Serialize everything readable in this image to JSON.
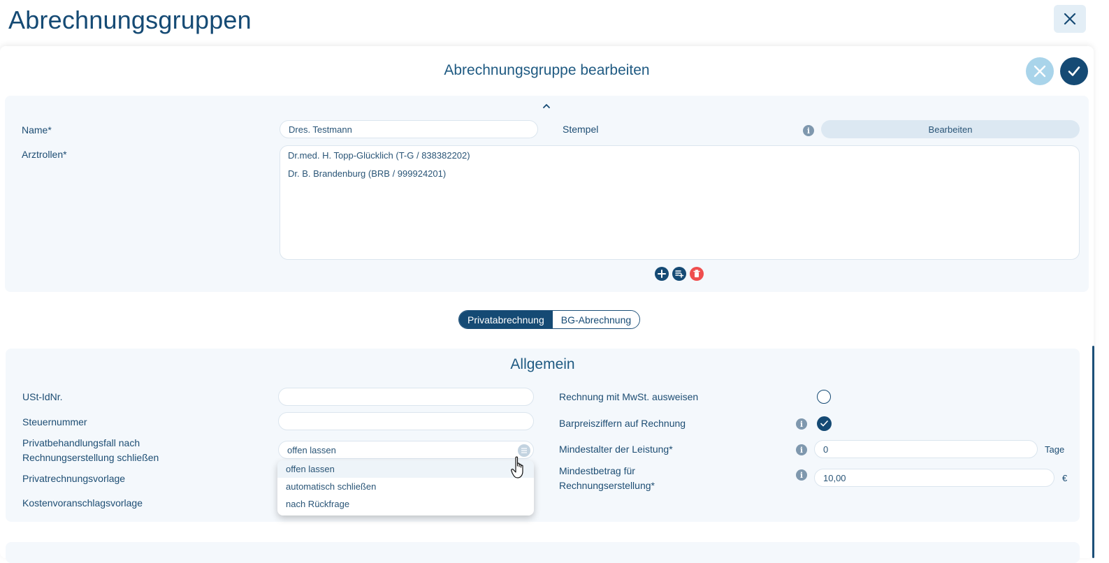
{
  "page": {
    "title": "Abrechnungsgruppen",
    "edit_title": "Abrechnungsgruppe bearbeiten"
  },
  "colors": {
    "primary": "#154a74",
    "cancel_circle": "#a9d4ea",
    "delete_red": "#ef4e4e",
    "section_bg": "#f4f8fc"
  },
  "top_section": {
    "name_label": "Name*",
    "name_value": "Dres. Testmann",
    "stempel_label": "Stempel",
    "stempel_button": "Bearbeiten",
    "arztrollen_label": "Arztrollen*",
    "arztrollen": [
      "Dr.med. H. Topp-Glücklich (T-G / 838382202)",
      "Dr. B. Brandenburg (BRB / 999924201)"
    ]
  },
  "tabs": {
    "items": [
      "Privatabrechnung",
      "BG-Abrechnung"
    ],
    "selected": "Privatabrechnung"
  },
  "allgemein": {
    "title": "Allgemein",
    "ust_label": "USt-IdNr.",
    "ust_value": "",
    "steuer_label": "Steuernummer",
    "steuer_value": "",
    "privat_fall_label_1": "Privatbehandlungsfall nach",
    "privat_fall_label_2": "Rechnungserstellung schließen",
    "privat_fall_value": "offen lassen",
    "privatrechnung_label": "Privatrechnungsvorlage",
    "kostenvoranschlag_label": "Kostenvoranschlagsvorlage",
    "dropdown_options": [
      "offen lassen",
      "automatisch schließen",
      "nach Rückfrage"
    ],
    "mwst_label": "Rechnung mit MwSt. ausweisen",
    "mwst_checked": false,
    "barpreis_label": "Barpreisziffern auf Rechnung",
    "barpreis_checked": true,
    "mindestalter_label": "Mindestalter der Leistung*",
    "mindestalter_value": "0",
    "mindestalter_unit": "Tage",
    "mindestbetrag_label_1": "Mindestbetrag für",
    "mindestbetrag_label_2": "Rechnungserstellung*",
    "mindestbetrag_value": "10,00",
    "mindestbetrag_unit": "€"
  }
}
